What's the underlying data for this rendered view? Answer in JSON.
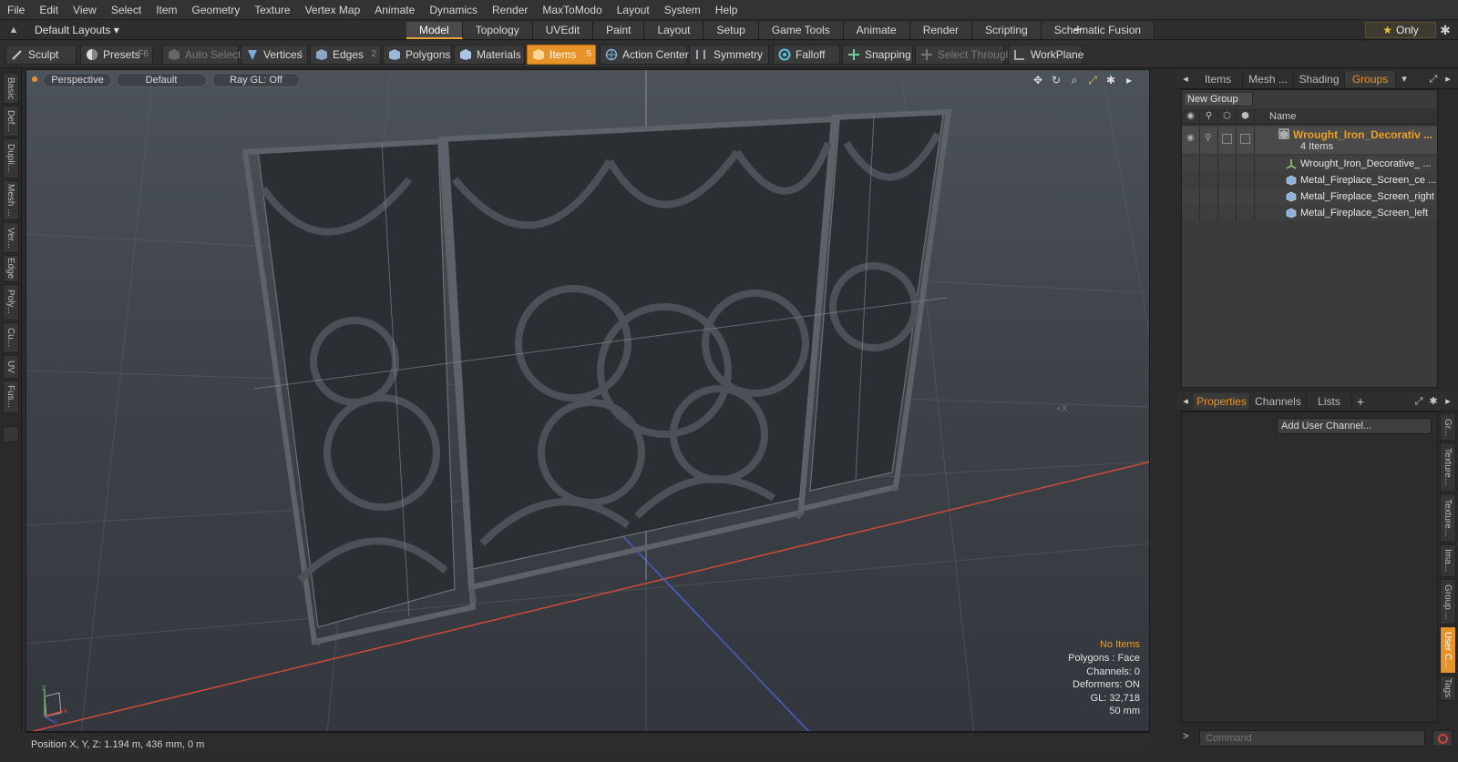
{
  "menu": [
    "File",
    "Edit",
    "View",
    "Select",
    "Item",
    "Geometry",
    "Texture",
    "Vertex Map",
    "Animate",
    "Dynamics",
    "Render",
    "MaxToModo",
    "Layout",
    "System",
    "Help"
  ],
  "layout": {
    "dropdown": "Default Layouts ▾",
    "tabs": [
      {
        "label": "Model",
        "active": true
      },
      {
        "label": "Topology"
      },
      {
        "label": "UVEdit"
      },
      {
        "label": "Paint"
      },
      {
        "label": "Layout"
      },
      {
        "label": "Setup"
      },
      {
        "label": "Game Tools"
      },
      {
        "label": "Animate"
      },
      {
        "label": "Render"
      },
      {
        "label": "Scripting"
      },
      {
        "label": "Schematic Fusion"
      }
    ],
    "add": "+",
    "only": "Only"
  },
  "toolbar": {
    "sculpt": "Sculpt",
    "presets": "Presets",
    "presets_key": "F6",
    "auto_select": "Auto Select",
    "vertices": "Vertices",
    "vertices_key": "1",
    "edges": "Edges",
    "edges_key": "2",
    "polygons": "Polygons",
    "materials": "Materials",
    "items": "Items",
    "items_key": "5",
    "action_center": "Action Center",
    "symmetry": "Symmetry",
    "falloff": "Falloff",
    "snapping": "Snapping",
    "select_through": "Select Through",
    "workplane": "WorkPlane"
  },
  "left_tabs": [
    "Basic",
    "Def...",
    "Dupli...",
    "Mesh ...",
    "Ver...",
    "Edge",
    "Poly...",
    "Cu...",
    "UV",
    "Fus..."
  ],
  "viewport": {
    "view": "Perspective",
    "shading": "Default",
    "raygl": "Ray GL: Off",
    "info": {
      "selection": "No Items",
      "polygons": "Polygons : Face",
      "channels": "Channels: 0",
      "deformers": "Deformers: ON",
      "gl": "GL: 32,718",
      "focal": "50 mm"
    }
  },
  "status": {
    "position": "Position X, Y, Z:   1.194 m, 436 mm, 0 m"
  },
  "top_panel": {
    "tabs": [
      {
        "label": "Items"
      },
      {
        "label": "Mesh ..."
      },
      {
        "label": "Shading"
      },
      {
        "label": "Groups",
        "active": true
      }
    ],
    "new_group": "New Group",
    "name_header": "Name",
    "group": {
      "name": "Wrought_Iron_Decorativ ...",
      "count": "4 Items"
    },
    "items": [
      {
        "name": "Wrought_Iron_Decorative_ ...",
        "icon": "locator-icon"
      },
      {
        "name": "Metal_Fireplace_Screen_ce ...",
        "icon": "mesh-icon"
      },
      {
        "name": "Metal_Fireplace_Screen_right",
        "icon": "mesh-icon"
      },
      {
        "name": "Metal_Fireplace_Screen_left",
        "icon": "mesh-icon"
      }
    ]
  },
  "bottom_panel": {
    "tabs": [
      {
        "label": "Properties",
        "active": true
      },
      {
        "label": "Channels"
      },
      {
        "label": "Lists"
      }
    ],
    "add": "+",
    "add_user_channel": "Add User Channel...",
    "side_tabs": [
      "Gr...",
      "Texture...",
      "Texture...",
      "Ima...",
      "Group ...",
      "User C...",
      "Tags"
    ]
  },
  "command": {
    "placeholder": "Command"
  },
  "colors": {
    "accent": "#e8932a",
    "group_text": "#f0a020",
    "x_axis": "#d04a3a",
    "z_axis": "#4a5ed0"
  }
}
